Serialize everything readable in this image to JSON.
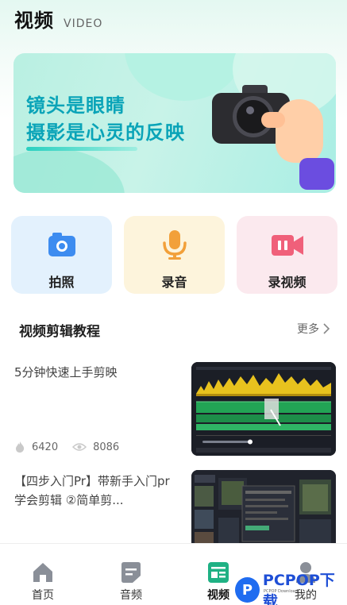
{
  "header": {
    "title": "视频",
    "subtitle": "VIDEO"
  },
  "banner": {
    "line1": "镜头是眼睛",
    "line2": "摄影是心灵的反映"
  },
  "quick_actions": [
    {
      "label": "拍照",
      "icon": "camera-icon",
      "color": "#3d8cf0"
    },
    {
      "label": "录音",
      "icon": "microphone-icon",
      "color": "#f2a03a"
    },
    {
      "label": "录视频",
      "icon": "video-camera-icon",
      "color": "#f0607a"
    }
  ],
  "section": {
    "title": "视频剪辑教程",
    "more": "更多"
  },
  "videos": [
    {
      "title": "5分钟快速上手剪映",
      "likes": "6420",
      "views": "8086"
    },
    {
      "title": "【四步入门Pr】带新手入门pr学会剪辑 ②简单剪..."
    }
  ],
  "tabbar": {
    "items": [
      {
        "label": "首页",
        "icon": "home-icon"
      },
      {
        "label": "音频",
        "icon": "audio-icon"
      },
      {
        "label": "视频",
        "icon": "video-icon",
        "active": true
      },
      {
        "label": "我的",
        "icon": "profile-icon"
      }
    ]
  },
  "watermark": {
    "text": "PCPOP下载",
    "small": "PCPOP Download"
  },
  "colors": {
    "accent": "#1fb184",
    "banner_text": "#0aa4b8"
  }
}
